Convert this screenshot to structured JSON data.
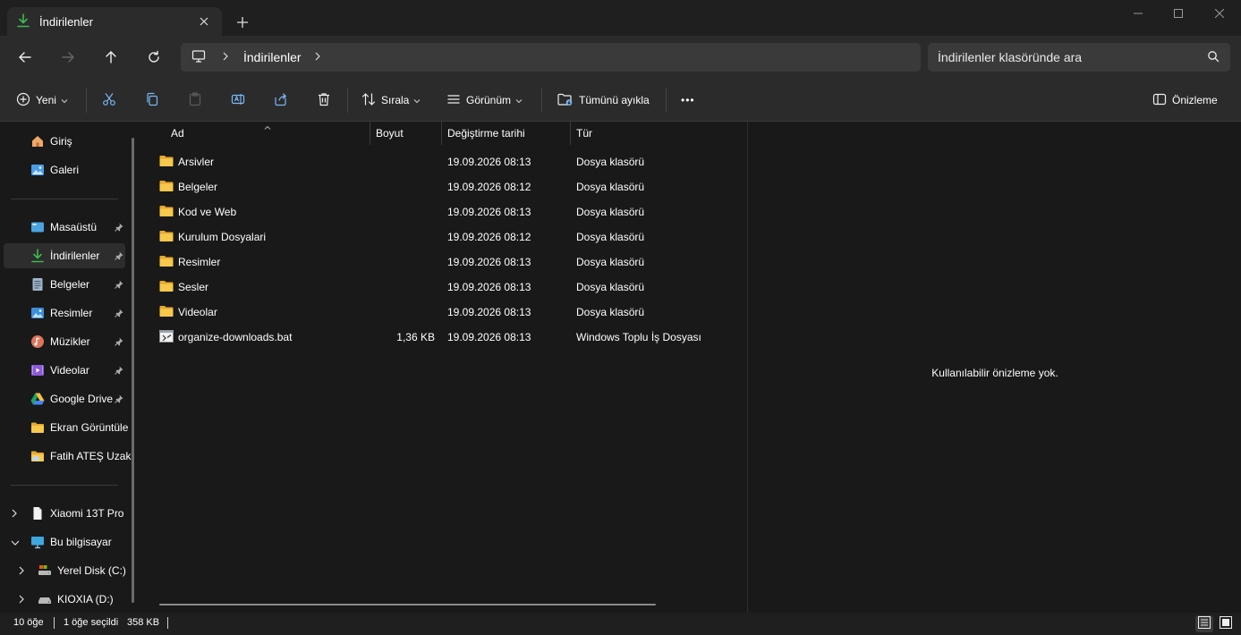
{
  "window": {
    "tab_title": "İndirilenler",
    "new_tab": "+"
  },
  "nav": {
    "breadcrumb": [
      "İndirilenler"
    ],
    "search_placeholder": "İndirilenler klasöründe ara"
  },
  "commands": {
    "new_label": "Yeni",
    "sort_label": "Sırala",
    "view_label": "Görünüm",
    "extract_label": "Tümünü ayıkla",
    "more_label": "•••",
    "preview_label": "Önizleme"
  },
  "sidebar": {
    "top": [
      {
        "label": "Giriş",
        "icon": "home-icon"
      },
      {
        "label": "Galeri",
        "icon": "gallery-icon"
      }
    ],
    "pinned": [
      {
        "label": "Masaüstü",
        "icon": "desktop-icon"
      },
      {
        "label": "İndirilenler",
        "icon": "download-icon"
      },
      {
        "label": "Belgeler",
        "icon": "documents-icon"
      },
      {
        "label": "Resimler",
        "icon": "pictures-icon"
      },
      {
        "label": "Müzikler",
        "icon": "music-icon"
      },
      {
        "label": "Videolar",
        "icon": "videos-icon"
      },
      {
        "label": "Google Drive",
        "icon": "google-drive-icon"
      },
      {
        "label": "Ekran Görüntüle",
        "icon": "folder-icon"
      },
      {
        "label": "Fatih ATEŞ Uzak",
        "icon": "folder-cloud-icon"
      }
    ],
    "devices": [
      {
        "label": "Xiaomi 13T Pro",
        "icon": "phone-icon"
      },
      {
        "label": "Bu bilgisayar",
        "icon": "computer-icon"
      },
      {
        "label": "Yerel Disk (C:)",
        "icon": "drive-icon"
      },
      {
        "label": "KIOXIA (D:)",
        "icon": "drive-icon"
      }
    ]
  },
  "columns": {
    "name": "Ad",
    "size": "Boyut",
    "modified": "Değiştirme tarihi",
    "type": "Tür"
  },
  "files": [
    {
      "name": "Arsivler",
      "size": "",
      "modified": "19.09.2026 08:13",
      "type": "Dosya klasörü",
      "icon": "folder-icon"
    },
    {
      "name": "Belgeler",
      "size": "",
      "modified": "19.09.2026 08:12",
      "type": "Dosya klasörü",
      "icon": "folder-icon"
    },
    {
      "name": "Kod ve Web",
      "size": "",
      "modified": "19.09.2026 08:13",
      "type": "Dosya klasörü",
      "icon": "folder-icon"
    },
    {
      "name": "Kurulum Dosyalari",
      "size": "",
      "modified": "19.09.2026 08:12",
      "type": "Dosya klasörü",
      "icon": "folder-icon"
    },
    {
      "name": "Resimler",
      "size": "",
      "modified": "19.09.2026 08:13",
      "type": "Dosya klasörü",
      "icon": "folder-icon"
    },
    {
      "name": "Sesler",
      "size": "",
      "modified": "19.09.2026 08:13",
      "type": "Dosya klasörü",
      "icon": "folder-icon"
    },
    {
      "name": "Videolar",
      "size": "",
      "modified": "19.09.2026 08:13",
      "type": "Dosya klasörü",
      "icon": "folder-icon"
    },
    {
      "name": "organize-downloads.bat",
      "size": "1,36 KB",
      "modified": "19.09.2026 08:13",
      "type": "Windows Toplu İş Dosyası",
      "icon": "batch-file-icon"
    }
  ],
  "preview": {
    "message": "Kullanılabilir önizleme yok."
  },
  "status": {
    "item_count": "10 öğe",
    "selection": "1 öğe seçildi",
    "selection_size": "358 KB"
  },
  "colors": {
    "background": "#191919",
    "toolbar": "#2b2b2b",
    "accent_download": "#3fb950",
    "folder": "#f5c244"
  }
}
